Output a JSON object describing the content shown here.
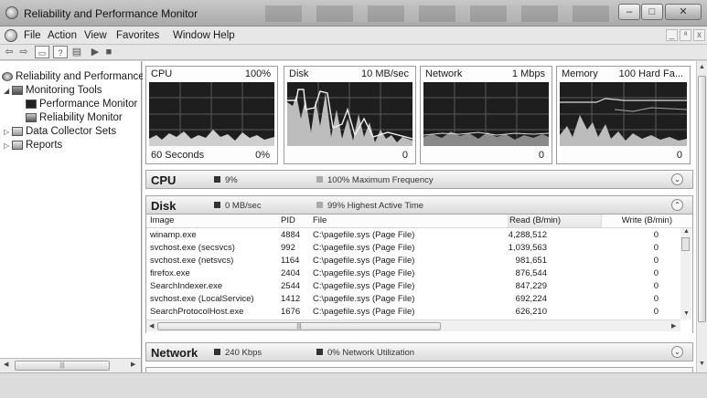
{
  "window": {
    "title": "Reliability and Performance Monitor"
  },
  "menubar": {
    "items": [
      "File",
      "Action",
      "View",
      "Favorites",
      "Window",
      "Help"
    ]
  },
  "tree": {
    "items": [
      {
        "label": "Reliability and Performance"
      },
      {
        "label": "Monitoring Tools"
      },
      {
        "label": "Performance Monitor"
      },
      {
        "label": "Reliability Monitor"
      },
      {
        "label": "Data Collector Sets"
      },
      {
        "label": "Reports"
      }
    ]
  },
  "graphs": [
    {
      "label": "CPU",
      "max": "100%",
      "left": "60 Seconds",
      "min": "0%"
    },
    {
      "label": "Disk",
      "max": "10 MB/sec",
      "min": "0"
    },
    {
      "label": "Network",
      "max": "1 Mbps",
      "min": "0"
    },
    {
      "label": "Memory",
      "max": "100 Hard Fa...",
      "min": "0"
    }
  ],
  "sections": {
    "cpu": {
      "title": "CPU",
      "val1": "9%",
      "val2": "100% Maximum Frequency"
    },
    "disk": {
      "title": "Disk",
      "val1": "0 MB/sec",
      "val2": "99% Highest Active Time"
    },
    "network": {
      "title": "Network",
      "val1": "240 Kbps",
      "val2": "0% Network Utilization"
    }
  },
  "disk_table": {
    "columns": [
      "Image",
      "PID",
      "File",
      "Read (B/min)",
      "Write (B/min)"
    ],
    "rows": [
      [
        "winamp.exe",
        "4884",
        "C:\\pagefile.sys (Page File)",
        "4,288,512",
        "0"
      ],
      [
        "svchost.exe (secsvcs)",
        "992",
        "C:\\pagefile.sys (Page File)",
        "1,039,563",
        "0"
      ],
      [
        "svchost.exe (netsvcs)",
        "1164",
        "C:\\pagefile.sys (Page File)",
        "981,651",
        "0"
      ],
      [
        "firefox.exe",
        "2404",
        "C:\\pagefile.sys (Page File)",
        "876,544",
        "0"
      ],
      [
        "SearchIndexer.exe",
        "2544",
        "C:\\pagefile.sys (Page File)",
        "847,229",
        "0"
      ],
      [
        "svchost.exe (LocalService)",
        "1412",
        "C:\\pagefile.sys (Page File)",
        "692,224",
        "0"
      ],
      [
        "SearchProtocolHost.exe",
        "1676",
        "C:\\pagefile.sys (Page File)",
        "626,210",
        "0"
      ]
    ]
  },
  "colors": {
    "graph_bg": "#1e1e1e",
    "graph_grid": "#5a5a5a",
    "graph_line": "#d9d9d9"
  }
}
